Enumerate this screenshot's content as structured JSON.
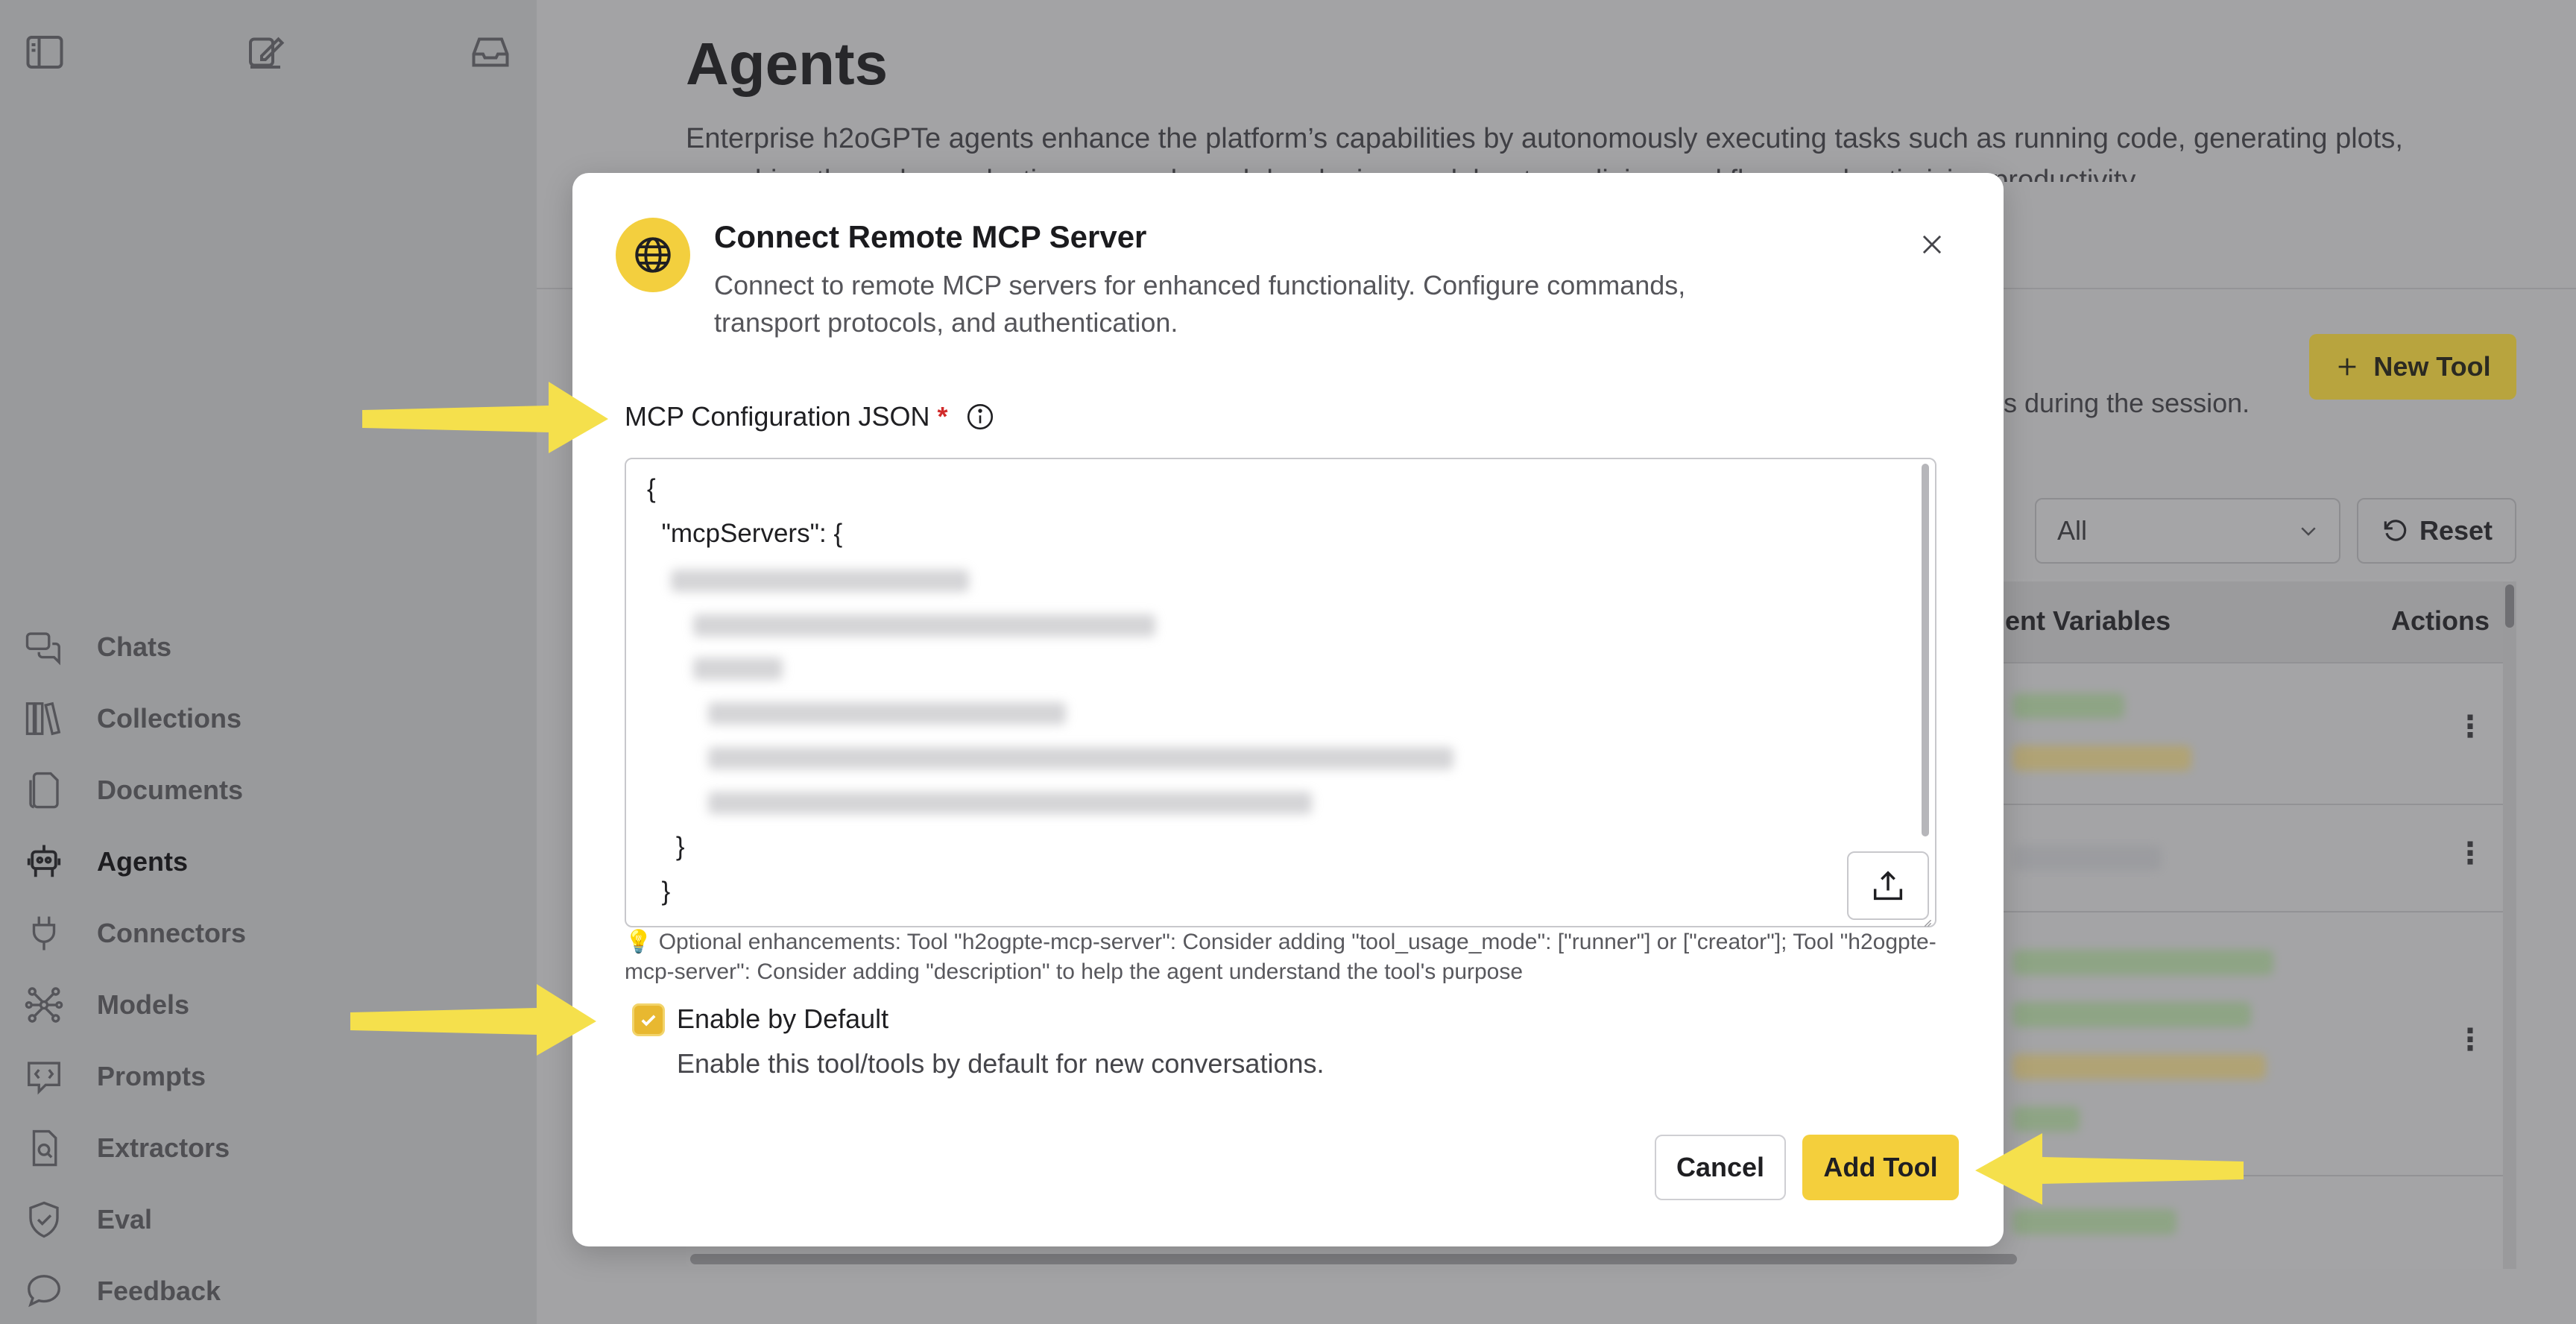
{
  "sidebar": {
    "top_icons": [
      "sidebar-toggle-icon",
      "new-chat-icon",
      "inbox-icon"
    ],
    "items": [
      {
        "label": "Chats",
        "icon": "chat-bubbles-icon",
        "active": false
      },
      {
        "label": "Collections",
        "icon": "books-icon",
        "active": false
      },
      {
        "label": "Documents",
        "icon": "documents-icon",
        "active": false
      },
      {
        "label": "Agents",
        "icon": "robot-icon",
        "active": true
      },
      {
        "label": "Connectors",
        "icon": "plug-icon",
        "active": false
      },
      {
        "label": "Models",
        "icon": "network-icon",
        "active": false
      },
      {
        "label": "Prompts",
        "icon": "code-message-icon",
        "active": false
      },
      {
        "label": "Extractors",
        "icon": "document-search-icon",
        "active": false
      },
      {
        "label": "Eval",
        "icon": "shield-check-icon",
        "active": false
      },
      {
        "label": "Feedback",
        "icon": "feedback-bubble-icon",
        "active": false
      }
    ]
  },
  "page": {
    "title": "Agents",
    "description": "Enterprise h2oGPTe agents enhance the platform’s capabilities by autonomously executing tasks such as running code, generating plots, searching the web, conducting research, and developing models, streamlining workflows and optimizing productivity.",
    "new_tool_label": "New Tool",
    "session_text_fragment": "s during the session.",
    "filter_value": "All",
    "reset_label": "Reset",
    "table_headers": {
      "env": "ent Variables",
      "actions": "Actions"
    }
  },
  "modal": {
    "icon": "globe-icon",
    "title": "Connect Remote MCP Server",
    "subtitle": "Connect to remote MCP servers for enhanced functionality. Configure commands, transport protocols, and authentication.",
    "field_label": "MCP Configuration JSON",
    "required_mark": "*",
    "json_lines": [
      "{",
      "  \"mcpServers\": {",
      "    }",
      "  }"
    ],
    "hint": "💡 Optional enhancements: Tool \"h2ogpte-mcp-server\": Consider adding \"tool_usage_mode\": [\"runner\"] or [\"creator\"]; Tool \"h2ogpte-mcp-server\": Consider adding \"description\" to help the agent understand the tool's purpose",
    "checkbox_label": "Enable by Default",
    "checkbox_checked": true,
    "checkbox_desc": "Enable this tool/tools by default for new conversations.",
    "cancel_label": "Cancel",
    "add_label": "Add Tool"
  },
  "colors": {
    "accent": "#f4cf3c",
    "annotation_arrow": "#f5e04c",
    "required": "#d12a2a"
  }
}
